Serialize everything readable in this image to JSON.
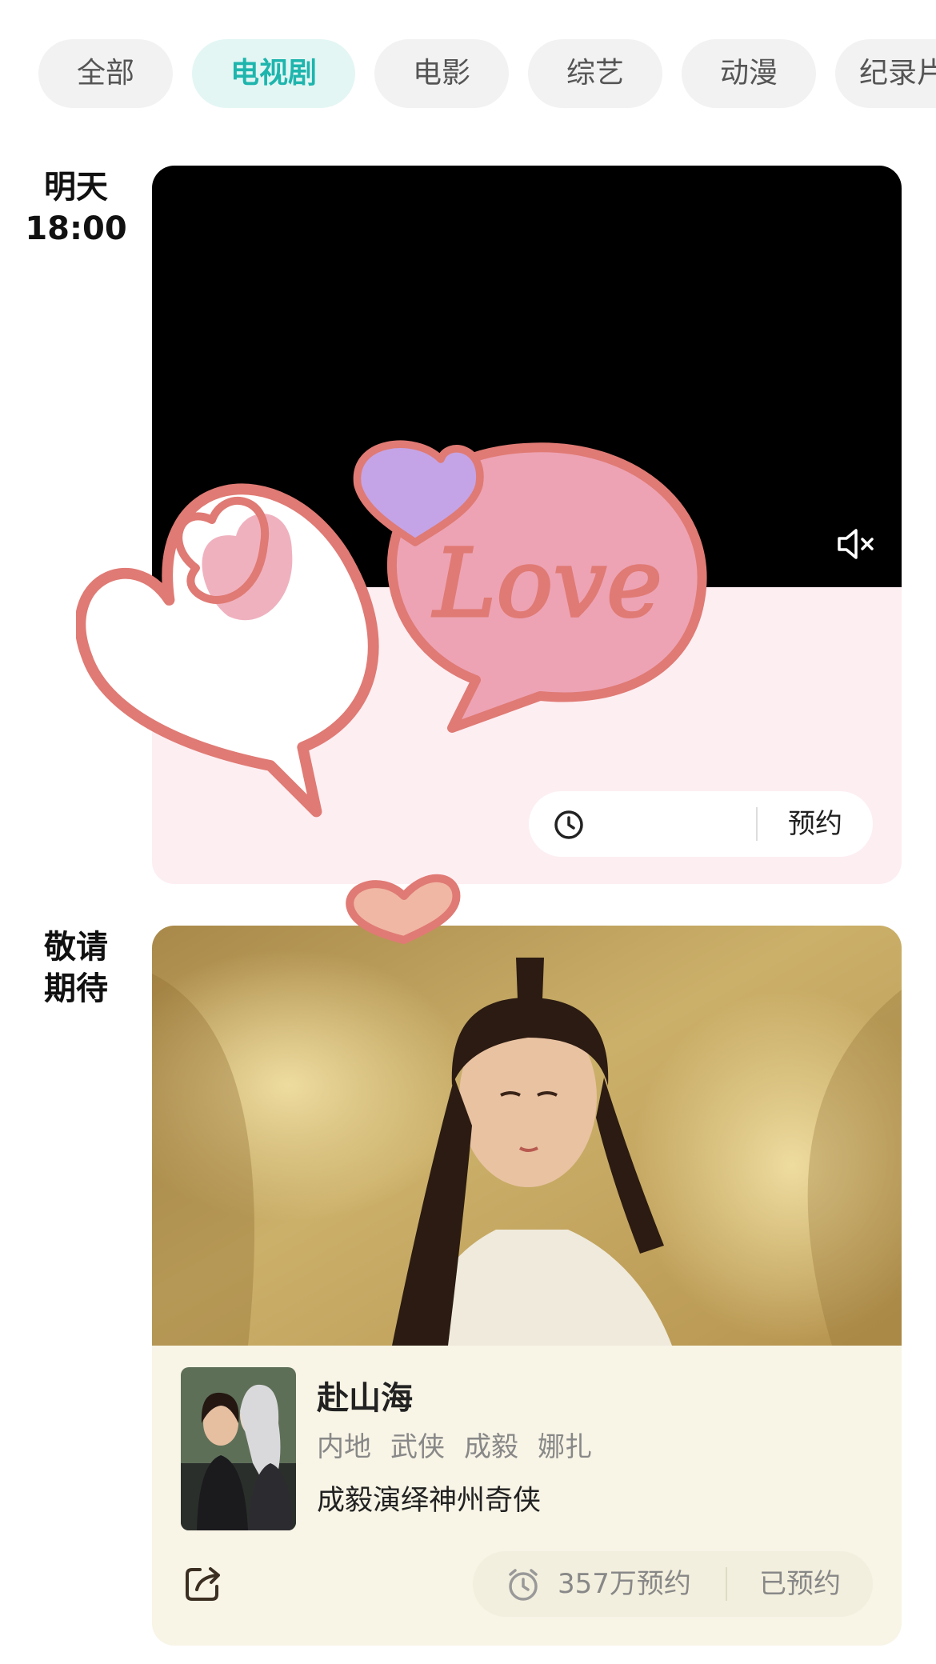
{
  "tabs": [
    {
      "label": "全部"
    },
    {
      "label": "电视剧"
    },
    {
      "label": "电影"
    },
    {
      "label": "综艺"
    },
    {
      "label": "动漫"
    },
    {
      "label": "纪录片"
    }
  ],
  "active_tab": "电视剧",
  "schedule": [
    {
      "time_day": "明天",
      "time_hour": "18:00",
      "reserve_label": "预约"
    },
    {
      "time_line1": "敬请",
      "time_line2": "期待",
      "title": "赴山海",
      "tags": [
        "内地",
        "武侠",
        "成毅",
        "娜扎"
      ],
      "description": "成毅演绎神州奇侠",
      "reserve_count": "357万预约",
      "reserved_label": "已预约"
    }
  ],
  "sticker": {
    "word": "Love"
  },
  "icons": {
    "mute": "speaker-muted-icon",
    "clock": "alarm-clock-icon",
    "share": "share-icon"
  },
  "colors": {
    "accent": "#1eb5ad",
    "active_tab_bg": "#e3f6f4",
    "card1_bg": "#fdeef2",
    "card2_bg": "#f8f4e6",
    "sticker_stroke": "#e07a74",
    "sticker_pink": "#eda3b4",
    "sticker_purple": "#c4a4e6"
  }
}
